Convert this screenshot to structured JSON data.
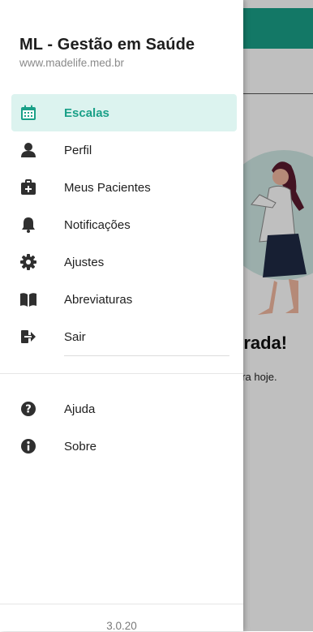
{
  "drawer": {
    "title": "ML - Gestão em Saúde",
    "subtitle": "www.madelife.med.br",
    "items": [
      {
        "label": "Escalas",
        "icon": "calendar-icon"
      },
      {
        "label": "Perfil",
        "icon": "user-icon"
      },
      {
        "label": "Meus Pacientes",
        "icon": "medical-kit-icon"
      },
      {
        "label": "Notificações",
        "icon": "bell-icon"
      },
      {
        "label": "Ajustes",
        "icon": "gear-icon"
      },
      {
        "label": "Abreviaturas",
        "icon": "book-icon"
      },
      {
        "label": "Sair",
        "icon": "sign-out-icon"
      }
    ],
    "secondary_items": [
      {
        "label": "Ajuda",
        "icon": "question-circle-icon"
      },
      {
        "label": "Sobre",
        "icon": "info-circle-icon"
      }
    ],
    "version": "3.0.20",
    "active_item": "Escalas"
  },
  "background": {
    "heading_partial": "trada!",
    "text_partial": "ara hoje."
  },
  "colors": {
    "accent": "#1aa088",
    "active_bg": "#dcf3ef",
    "icon": "#2f2f2f"
  }
}
